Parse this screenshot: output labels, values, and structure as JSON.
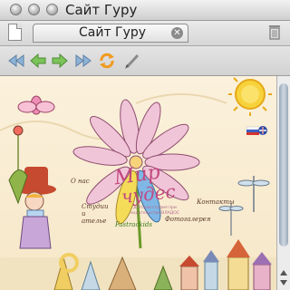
{
  "window": {
    "title": "Сайт Гуру"
  },
  "tabs": [
    {
      "label": "Сайт Гуру",
      "active": true
    }
  ],
  "toolbar": {
    "icons": [
      "rewind-icon",
      "back-icon",
      "forward-icon",
      "fast-forward-icon",
      "reload-icon",
      "pen-icon"
    ]
  },
  "page": {
    "logo_line1": "Мир",
    "logo_line2": "чудес",
    "logo_subtitle": "Детская студия при издательстве ВЛАДОС",
    "nav": {
      "about": "О нас",
      "studios": "Студии и ателье",
      "contacts": "Контакты",
      "photo": "Фотогалерея",
      "fastrackids": "Fastrackids"
    }
  }
}
